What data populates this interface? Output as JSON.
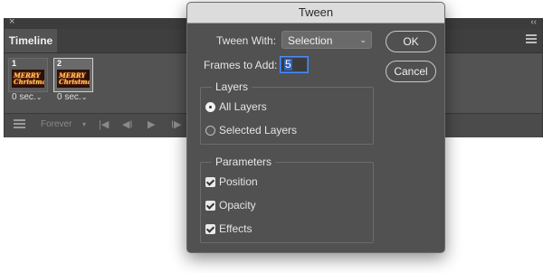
{
  "timeline": {
    "close_glyph": "×",
    "collapse_glyph": "‹‹",
    "tab_label": "Timeline",
    "frames": [
      {
        "number": "1",
        "thumb_line1": "MERRY",
        "thumb_line2": "Christmas",
        "delay": "0 sec.",
        "selected": false
      },
      {
        "number": "2",
        "thumb_line1": "MERRY",
        "thumb_line2": "Christmas",
        "delay": "0 sec.",
        "selected": true
      }
    ],
    "delay_chevron": "⌄",
    "loop_label": "Forever",
    "loop_chevron": "▾",
    "controls": {
      "first_frame": "|◀",
      "prev_frame": "◀I",
      "play": "▶",
      "next_frame": "I▶"
    }
  },
  "dialog": {
    "title": "Tween",
    "tween_with_label": "Tween With:",
    "tween_with_value": "Selection",
    "tween_with_chevron": "⌄",
    "frames_to_add_label": "Frames to Add:",
    "frames_to_add_value": "5",
    "ok_label": "OK",
    "cancel_label": "Cancel",
    "layers": {
      "title": "Layers",
      "options": [
        {
          "label": "All Layers",
          "selected": true
        },
        {
          "label": "Selected Layers",
          "selected": false
        }
      ]
    },
    "parameters": {
      "title": "Parameters",
      "items": [
        {
          "label": "Position",
          "checked": true
        },
        {
          "label": "Opacity",
          "checked": true
        },
        {
          "label": "Effects",
          "checked": true
        }
      ]
    }
  },
  "colors": {
    "panel_bg": "#535353",
    "dialog_bg": "#515151",
    "title_bar": "#dcdcdc",
    "focus_blue": "#2b6fd4"
  }
}
